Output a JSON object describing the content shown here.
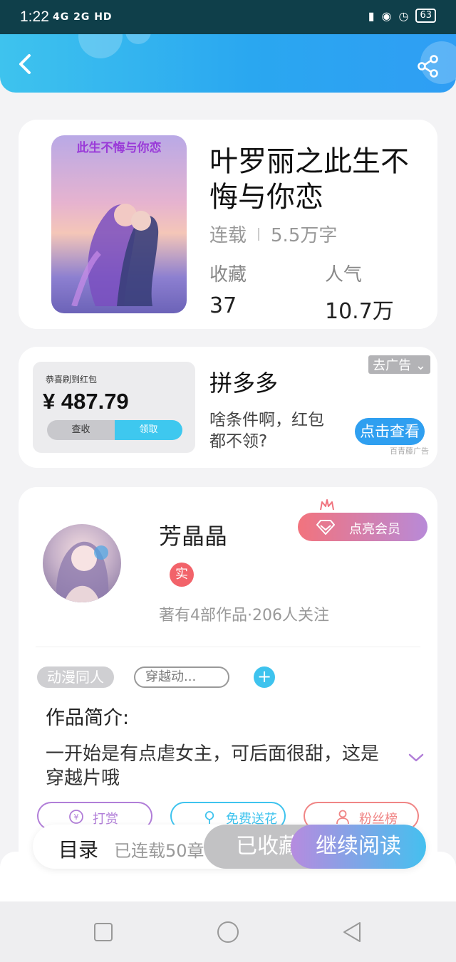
{
  "status_bar": {
    "time": "1:22",
    "network": "4G 2G HD",
    "battery": "63"
  },
  "book": {
    "cover_title": "此生不悔与你恋",
    "title": "叶罗丽之此生不悔与你恋",
    "status": "连载",
    "word_count": "5.5万字",
    "favorites_label": "收藏",
    "favorites_value": "37",
    "popularity_label": "人气",
    "popularity_value": "10.7万"
  },
  "ad": {
    "image_caption": "恭喜刷到红包",
    "image_amount": "¥ 487.79",
    "image_btn_check": "查收",
    "image_btn_claim": "领取",
    "title": "拼多多",
    "description": "啥条件啊，红包都不领?",
    "remove_label": "去广告",
    "cta_label": "点击查看",
    "source_label": "百青藤广告"
  },
  "author": {
    "name": "芳晶晶",
    "verified_label": "实",
    "stats": "著有4部作品·206人关注",
    "vip_label": "点亮会员"
  },
  "tags": {
    "tag1": "动漫同人",
    "tag2": "穿越动...",
    "add_label": "+"
  },
  "intro": {
    "heading": "作品简介:",
    "text": "一开始是有点虐女主，可后面很甜，这是穿越片哦"
  },
  "actions": {
    "tip": "打赏",
    "flower": "免费送花",
    "fans": "粉丝榜"
  },
  "bottom_bar": {
    "toc_label": "目录",
    "toc_count": "已连载50章",
    "favorited_label": "已收藏",
    "continue_label": "继续阅读"
  },
  "colors": {
    "header_start": "#3ec3ee",
    "header_end": "#2f9ef4",
    "accent_blue": "#3ec3ee",
    "tip_purple": "#b17ed8",
    "flower_cyan": "#3ec3ee",
    "fans_red": "#f08585"
  }
}
